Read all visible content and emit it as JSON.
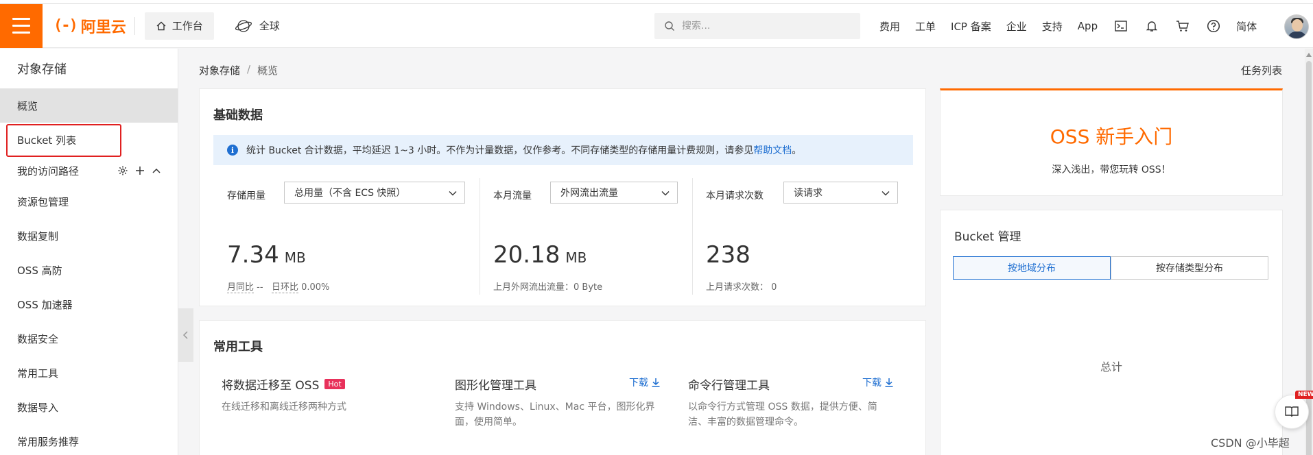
{
  "topbar": {
    "logo_text": "阿里云",
    "workbench": "工作台",
    "region": "全球",
    "search_placeholder": "搜索...",
    "nav": [
      "费用",
      "工单",
      "ICP 备案",
      "企业",
      "支持",
      "App"
    ],
    "lang": "简体"
  },
  "sidebar": {
    "title": "对象存储",
    "items": [
      "概览",
      "Bucket 列表"
    ],
    "group": "我的访问路径",
    "items2": [
      "资源包管理",
      "数据复制",
      "OSS 高防",
      "OSS 加速器",
      "数据安全",
      "常用工具",
      "数据导入",
      "常用服务推荐"
    ]
  },
  "breadcrumb": {
    "root": "对象存储",
    "sep": "/",
    "current": "概览"
  },
  "tasklist": "任务列表",
  "basic": {
    "title": "基础数据",
    "notice_text": "统计 Bucket 合计数据，平均延迟 1~3 小时。不作为计量数据，仅作参考。不同存储类型的存储用量计费规则，请参见",
    "notice_link": "帮助文档",
    "notice_end": "。",
    "storage": {
      "label": "存储用量",
      "select": "总用量（不含 ECS 快照）",
      "value": "7.34",
      "unit": "MB",
      "mom_label": "月同比",
      "mom_value": "--",
      "dod_label": "日环比",
      "dod_value": "0.00%"
    },
    "traffic": {
      "label": "本月流量",
      "select": "外网流出流量",
      "value": "20.18",
      "unit": "MB",
      "sub": "上月外网流出流量：0 Byte"
    },
    "requests": {
      "label": "本月请求次数",
      "select": "读请求",
      "value": "238",
      "sub": "上月请求次数：  0"
    }
  },
  "tools": {
    "title": "常用工具",
    "items": [
      {
        "title": "将数据迁移至 OSS",
        "badge": "Hot",
        "desc": "在线迁移和离线迁移两种方式"
      },
      {
        "title": "图形化管理工具",
        "download": "下载",
        "desc": "支持 Windows、Linux、Mac 平台，图形化界面，使用简单。"
      },
      {
        "title": "命令行管理工具",
        "download": "下载",
        "desc": "以命令行方式管理 OSS 数据，提供方便、简洁、丰富的数据管理命令。"
      }
    ]
  },
  "newbie": {
    "title": "OSS 新手入门",
    "subtitle": "深入浅出，带您玩转 OSS！"
  },
  "bucket": {
    "title": "Bucket 管理",
    "tabs": [
      "按地域分布",
      "按存储类型分布"
    ],
    "total": "总计"
  },
  "float_badge": "NEW",
  "watermark": "CSDN @小毕超",
  "colors": {
    "brand": "#ff6a00",
    "link": "#1f6fd1",
    "highlight_box": "#e02020",
    "hot": "#e8315b"
  }
}
